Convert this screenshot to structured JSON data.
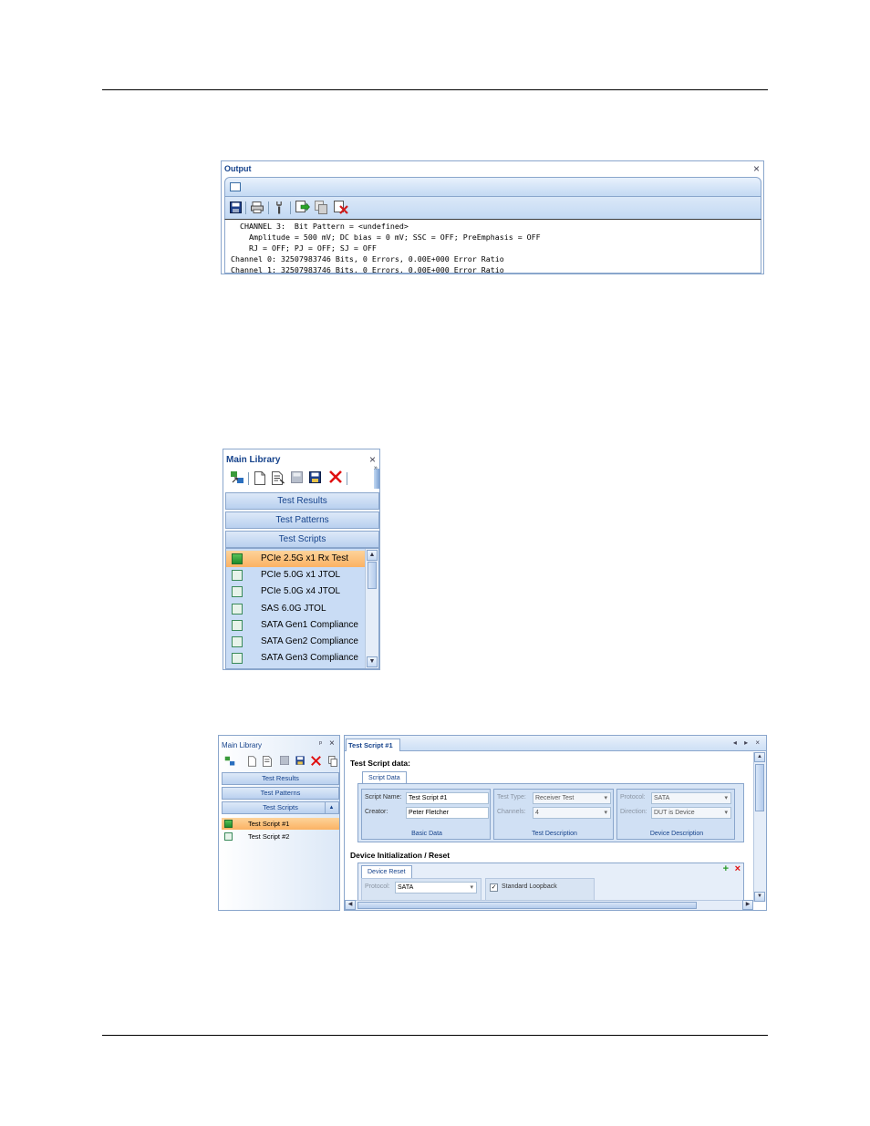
{
  "output_panel": {
    "title": "Output",
    "close": "×",
    "console_lines": [
      "  CHANNEL 3:  Bit Pattern = <undefined>",
      "    Amplitude = 500 mV; DC bias = 0 mV; SSC = OFF; PreEmphasis = OFF",
      "    RJ = OFF; PJ = OFF; SJ = OFF",
      "Channel 0: 32507983746 Bits, 0 Errors, 0.00E+000 Error Ratio",
      "Channel 1: 32507983746 Bits, 0 Errors, 0.00E+000 Error Ratio"
    ],
    "toolbar_icons": [
      "save-icon",
      "print-icon",
      "settings-icon",
      "export-green-icon",
      "copy-icon",
      "clear-red-icon"
    ]
  },
  "main_library": {
    "title": "Main Library",
    "close": "×",
    "toolbar_overflow": "»",
    "nav": [
      "Test Results",
      "Test Patterns",
      "Test Scripts"
    ],
    "items": [
      {
        "label": "PCIe 2.5G x1 Rx Test",
        "selected": true
      },
      {
        "label": "PCIe 5.0G x1 JTOL",
        "selected": false
      },
      {
        "label": "PCIe 5.0G x4 JTOL",
        "selected": false
      },
      {
        "label": "SAS 6.0G JTOL",
        "selected": false
      },
      {
        "label": "SATA Gen1 Compliance",
        "selected": false
      },
      {
        "label": "SATA Gen2 Compliance",
        "selected": false
      },
      {
        "label": "SATA Gen3 Compliance",
        "selected": false
      }
    ]
  },
  "window": {
    "left": {
      "title": "Main Library",
      "pin": "ᵖ",
      "close": "×",
      "nav": [
        "Test Results",
        "Test Patterns",
        "Test Scripts"
      ],
      "items": [
        {
          "label": "Test Script #1",
          "selected": true
        },
        {
          "label": "Test Script #2",
          "selected": false
        }
      ]
    },
    "doc_tab": "Test Script #1",
    "doc_nav": "◂ ▸ ×",
    "script_data": {
      "heading": "Test Script data:",
      "tab": "Script Data",
      "basic": {
        "name_label": "Script Name:",
        "name_value": "Test Script #1",
        "creator_label": "Creator:",
        "creator_value": "Peter Fletcher",
        "footer": "Basic Data"
      },
      "test": {
        "type_label": "Test Type:",
        "type_value": "Receiver Test",
        "channels_label": "Channels:",
        "channels_value": "4",
        "footer": "Test Description"
      },
      "device": {
        "protocol_label": "Protocol:",
        "protocol_value": "SATA",
        "direction_label": "Direction:",
        "direction_value": "DUT is Device",
        "footer": "Device Description"
      }
    },
    "device_init": {
      "heading": "Device Initialization / Reset",
      "tab": "Device Reset",
      "protocol_label": "Protocol:",
      "protocol_value": "SATA",
      "checkbox_label": "Standard Loopback",
      "add_icon": "+",
      "remove_icon": "×"
    }
  }
}
